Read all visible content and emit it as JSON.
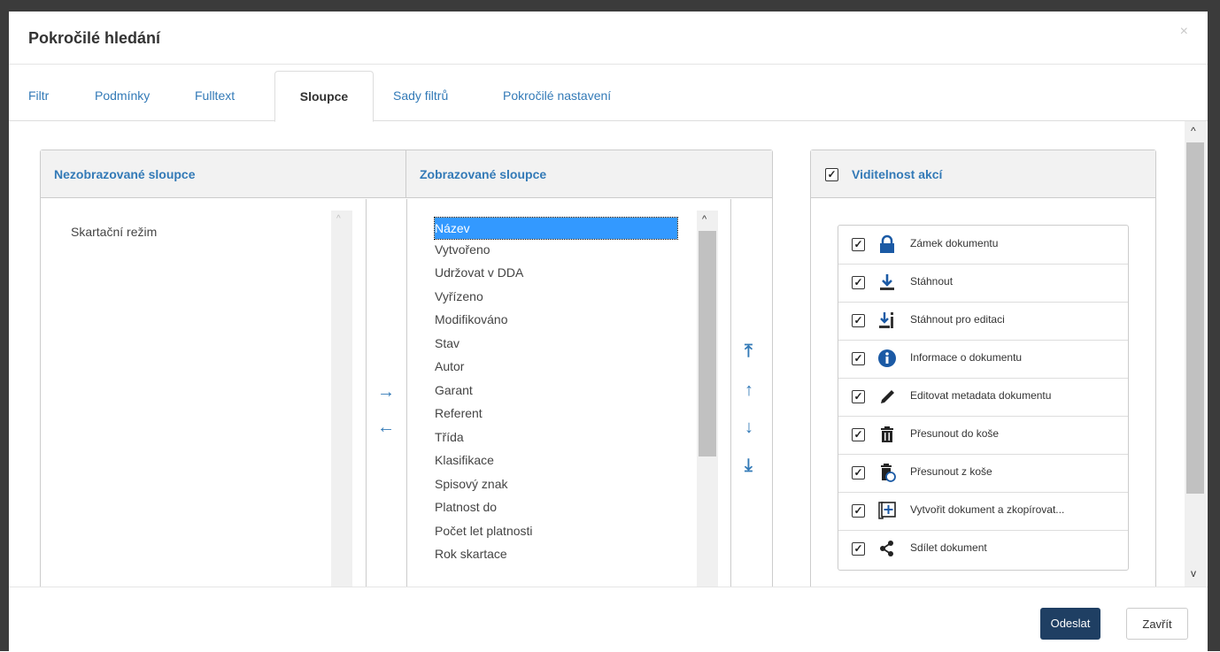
{
  "modal": {
    "title": "Pokročilé hledání",
    "close_label": "×"
  },
  "tabs": [
    {
      "label": "Filtr"
    },
    {
      "label": "Podmínky"
    },
    {
      "label": "Fulltext"
    },
    {
      "label": "Sloupce",
      "active": true
    },
    {
      "label": "Sady filtrů"
    },
    {
      "label": "Pokročilé nastavení"
    }
  ],
  "hidden_columns": {
    "header": "Nezobrazované sloupce",
    "items": [
      "Skartační režim"
    ]
  },
  "shown_columns": {
    "header": "Zobrazované sloupce",
    "items": [
      "Název",
      "Vytvořeno",
      "Udržovat v DDA",
      "Vyřízeno",
      "Modifikováno",
      "Stav",
      "Autor",
      "Garant",
      "Referent",
      "Třída",
      "Klasifikace",
      "Spisový znak",
      "Platnost do",
      "Počet let platnosti",
      "Rok skartace"
    ],
    "selected": "Název"
  },
  "transfer_arrows": {
    "right": "→",
    "left": "←"
  },
  "order_arrows": {
    "top": "⤒",
    "up": "↑",
    "down": "↓",
    "bottom": "⤓"
  },
  "actions": {
    "header": "Viditelnost akcí",
    "header_checked": true,
    "items": [
      {
        "label": "Zámek dokumentu",
        "icon": "lock-icon",
        "checked": true
      },
      {
        "label": "Stáhnout",
        "icon": "download-icon",
        "checked": true
      },
      {
        "label": "Stáhnout pro editaci",
        "icon": "download-edit-icon",
        "checked": true
      },
      {
        "label": "Informace o dokumentu",
        "icon": "info-icon",
        "checked": true
      },
      {
        "label": "Editovat metadata dokumentu",
        "icon": "pencil-icon",
        "checked": true
      },
      {
        "label": "Přesunout do koše",
        "icon": "trash-icon",
        "checked": true
      },
      {
        "label": "Přesunout z koše",
        "icon": "trash-restore-icon",
        "checked": true
      },
      {
        "label": "Vytvořit dokument a zkopírovat...",
        "icon": "copy-plus-icon",
        "checked": true
      },
      {
        "label": "Sdílet dokument",
        "icon": "share-icon",
        "checked": true
      }
    ]
  },
  "footer": {
    "submit_label": "Odeslat",
    "close_label": "Zavřít"
  },
  "colors": {
    "accent": "#337ab7",
    "primary_button": "#1f3f63",
    "selection": "#3399ff"
  }
}
